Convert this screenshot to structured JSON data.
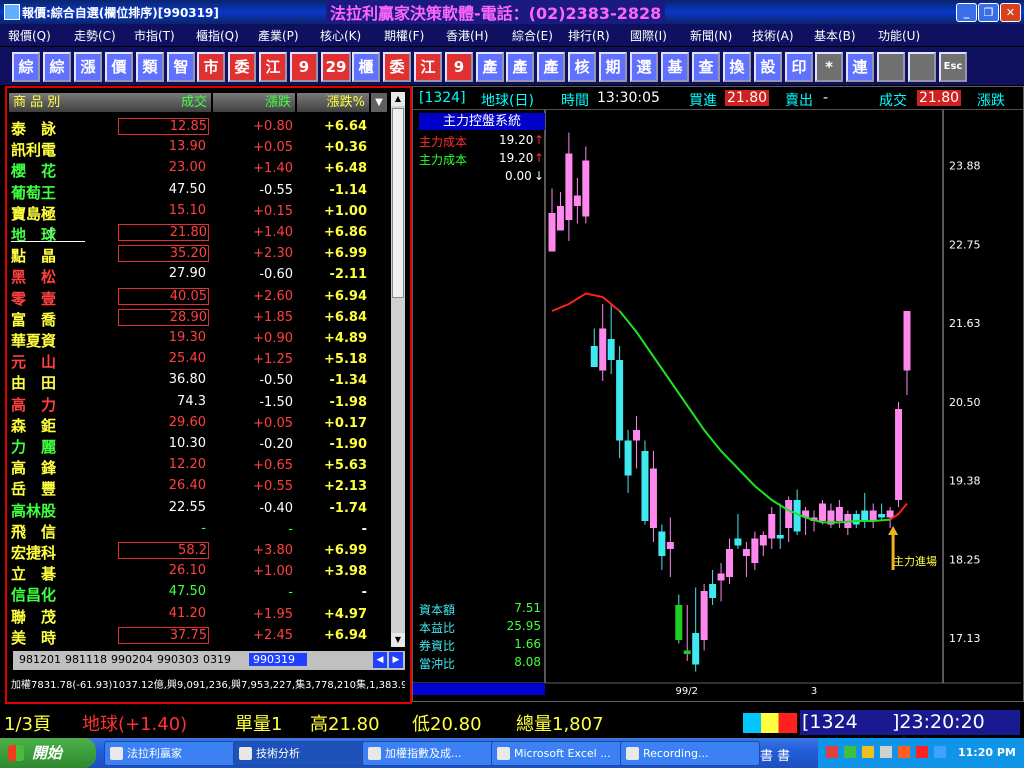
{
  "window": {
    "title": "報價:綜合自選(欄位排序)[990319]",
    "promo": "法拉利贏家決策軟體-電話：(02)2383-2828"
  },
  "menu": [
    "報價(Q)",
    "走勢(C)",
    "市指(T)",
    "櫃指(Q)",
    "產業(P)",
    "核心(K)",
    "期權(F)",
    "香港(H)",
    "綜合(E)",
    "排行(R)",
    "國際(I)",
    "新聞(N)",
    "技術(A)",
    "基本(B)",
    "功能(U)"
  ],
  "toolbar": [
    "綜",
    "綜",
    "漲",
    "價",
    "類",
    "智",
    "市",
    "委",
    "江",
    "9",
    "29",
    "櫃",
    "委",
    "江",
    "9",
    "產",
    "產",
    "產",
    "核",
    "期",
    "選",
    "基",
    "查",
    "換",
    "設",
    "印",
    "*",
    "連",
    "",
    "",
    "Esc"
  ],
  "quote_table": {
    "headers": {
      "name": "商 品 別",
      "price": "成交",
      "change": "漲跌",
      "pct": "漲跌%"
    },
    "rows": [
      {
        "name": "泰　詠",
        "price": "12.85",
        "change": "+0.80",
        "pct": "+6.64",
        "boxed": true
      },
      {
        "name": "訊利電",
        "price": "13.90",
        "change": "+0.05",
        "pct": "+0.36",
        "boxed": false
      },
      {
        "name": "櫻　花",
        "price": "23.00",
        "change": "+1.40",
        "pct": "+6.48",
        "boxed": false
      },
      {
        "name": "葡萄王",
        "price": "47.50",
        "change": "-0.55",
        "pct": "-1.14",
        "boxed": false
      },
      {
        "name": "寶島極",
        "price": "15.10",
        "change": "+0.15",
        "pct": "+1.00",
        "boxed": false
      },
      {
        "name": "地　球",
        "price": "21.80",
        "change": "+1.40",
        "pct": "+6.86",
        "boxed": true
      },
      {
        "name": "點　晶",
        "price": "35.20",
        "change": "+2.30",
        "pct": "+6.99",
        "boxed": true
      },
      {
        "name": "黑　松",
        "price": "27.90",
        "change": "-0.60",
        "pct": "-2.11",
        "boxed": false
      },
      {
        "name": "零　壹",
        "price": "40.05",
        "change": "+2.60",
        "pct": "+6.94",
        "boxed": true
      },
      {
        "name": "富　喬",
        "price": "28.90",
        "change": "+1.85",
        "pct": "+6.84",
        "boxed": true
      },
      {
        "name": "華夏資",
        "price": "19.30",
        "change": "+0.90",
        "pct": "+4.89",
        "boxed": false
      },
      {
        "name": "元　山",
        "price": "25.40",
        "change": "+1.25",
        "pct": "+5.18",
        "boxed": false
      },
      {
        "name": "由　田",
        "price": "36.80",
        "change": "-0.50",
        "pct": "-1.34",
        "boxed": false
      },
      {
        "name": "高　力",
        "price": "74.3",
        "change": "-1.50",
        "pct": "-1.98",
        "boxed": false
      },
      {
        "name": "森　鉅",
        "price": "29.60",
        "change": "+0.05",
        "pct": "+0.17",
        "boxed": false
      },
      {
        "name": "力　麗",
        "price": "10.30",
        "change": "-0.20",
        "pct": "-1.90",
        "boxed": false
      },
      {
        "name": "高　鋒",
        "price": "12.20",
        "change": "+0.65",
        "pct": "+5.63",
        "boxed": false
      },
      {
        "name": "岳　豐",
        "price": "26.40",
        "change": "+0.55",
        "pct": "+2.13",
        "boxed": false
      },
      {
        "name": "高林股",
        "price": "22.55",
        "change": "-0.40",
        "pct": "-1.74",
        "boxed": false
      },
      {
        "name": "飛　信",
        "price": "-",
        "change": "-",
        "pct": "-",
        "boxed": false
      },
      {
        "name": "宏捷科",
        "price": "58.2",
        "change": "+3.80",
        "pct": "+6.99",
        "boxed": true
      },
      {
        "name": "立　碁",
        "price": "26.10",
        "change": "+1.00",
        "pct": "+3.98",
        "boxed": false
      },
      {
        "name": "信昌化",
        "price": "47.50",
        "change": "-",
        "pct": "-",
        "boxed": false
      },
      {
        "name": "聯　茂",
        "price": "41.20",
        "change": "+1.95",
        "pct": "+4.97",
        "boxed": false
      },
      {
        "name": "美　時",
        "price": "37.75",
        "change": "+2.45",
        "pct": "+6.94",
        "boxed": true
      }
    ]
  },
  "sheet_tabs": [
    "981201",
    "981118",
    "990204",
    "990303",
    "0319",
    "990319"
  ],
  "ticker_text": "加權7831.78(-61.93)1037.12億,興9,091,236,興7,953,227,集3,778,210集,1,383.9",
  "chart_header": {
    "code": "[1324]",
    "name": "地球(日)",
    "time_label": "時間",
    "time": "13:30:05",
    "bid_label": "買進",
    "bid": "21.80",
    "ask_label": "賣出",
    "ask": "-",
    "last_label": "成交",
    "last": "21.80",
    "chg_label": "漲跌"
  },
  "indicator": {
    "title": "主力控盤系統",
    "line1_label": "主力成本",
    "line1_value": "19.20",
    "line2_label": "主力成本",
    "line2_value": "19.20",
    "line3_value": "0.00"
  },
  "fundamentals": [
    {
      "label": "資本額",
      "value": "7.51"
    },
    {
      "label": "本益比",
      "value": "25.95"
    },
    {
      "label": "券資比",
      "value": "1.66"
    },
    {
      "label": "當沖比",
      "value": "8.08"
    }
  ],
  "annotation": "主力進場",
  "colors": {
    "up": "#ff4040",
    "down": "#40ff40",
    "bull_candle": "#ff88ee",
    "bear_candle": "#40e8f0",
    "ma_red": "#ff2020",
    "ma_green": "#20e020"
  },
  "chart_data": {
    "type": "candlestick",
    "y_ticks": [
      "23.88",
      "22.75",
      "21.63",
      "20.50",
      "19.38",
      "18.25",
      "17.13"
    ],
    "ylim": [
      16.6,
      24.6
    ],
    "x_labels": [
      "99/2",
      "3"
    ],
    "candles": [
      {
        "o": 22.65,
        "h": 23.55,
        "l": 22.65,
        "c": 23.2
      },
      {
        "o": 22.95,
        "h": 23.5,
        "l": 22.95,
        "c": 23.3
      },
      {
        "o": 23.1,
        "h": 24.35,
        "l": 22.8,
        "c": 24.05
      },
      {
        "o": 23.3,
        "h": 23.7,
        "l": 23.05,
        "c": 23.45
      },
      {
        "o": 23.15,
        "h": 24.15,
        "l": 23.05,
        "c": 23.95
      },
      {
        "o": 21.3,
        "h": 21.55,
        "l": 21.0,
        "c": 21.0
      },
      {
        "o": 20.95,
        "h": 21.9,
        "l": 20.8,
        "c": 21.55
      },
      {
        "o": 21.4,
        "h": 21.9,
        "l": 20.9,
        "c": 21.1
      },
      {
        "o": 21.1,
        "h": 21.3,
        "l": 19.7,
        "c": 19.95
      },
      {
        "o": 19.95,
        "h": 20.1,
        "l": 19.2,
        "c": 19.45
      },
      {
        "o": 19.95,
        "h": 20.3,
        "l": 19.55,
        "c": 20.1
      },
      {
        "o": 19.8,
        "h": 19.95,
        "l": 18.75,
        "c": 18.8
      },
      {
        "o": 18.7,
        "h": 19.8,
        "l": 18.5,
        "c": 19.55
      },
      {
        "o": 18.65,
        "h": 18.75,
        "l": 18.1,
        "c": 18.3
      },
      {
        "o": 18.4,
        "h": 18.85,
        "l": 18.0,
        "c": 18.5
      },
      {
        "o": 17.6,
        "h": 17.75,
        "l": 17.05,
        "c": 17.1
      },
      {
        "o": 16.9,
        "h": 17.6,
        "l": 16.8,
        "c": 16.95
      },
      {
        "o": 17.2,
        "h": 17.85,
        "l": 16.65,
        "c": 16.75
      },
      {
        "o": 17.1,
        "h": 17.9,
        "l": 16.95,
        "c": 17.8
      },
      {
        "o": 17.9,
        "h": 18.1,
        "l": 17.6,
        "c": 17.7
      },
      {
        "o": 17.95,
        "h": 18.2,
        "l": 17.65,
        "c": 18.05
      },
      {
        "o": 18.0,
        "h": 18.55,
        "l": 17.9,
        "c": 18.4
      },
      {
        "o": 18.55,
        "h": 18.9,
        "l": 18.4,
        "c": 18.45
      },
      {
        "o": 18.3,
        "h": 18.5,
        "l": 18.0,
        "c": 18.4
      },
      {
        "o": 18.2,
        "h": 18.65,
        "l": 18.1,
        "c": 18.55
      },
      {
        "o": 18.45,
        "h": 18.65,
        "l": 18.3,
        "c": 18.6
      },
      {
        "o": 18.55,
        "h": 19.0,
        "l": 18.4,
        "c": 18.9
      },
      {
        "o": 18.6,
        "h": 19.05,
        "l": 18.4,
        "c": 18.55
      },
      {
        "o": 18.7,
        "h": 19.15,
        "l": 18.5,
        "c": 19.1
      },
      {
        "o": 19.1,
        "h": 19.25,
        "l": 18.6,
        "c": 18.65
      },
      {
        "o": 18.85,
        "h": 19.0,
        "l": 18.6,
        "c": 18.95
      },
      {
        "o": 18.8,
        "h": 18.95,
        "l": 18.65,
        "c": 18.85
      },
      {
        "o": 18.8,
        "h": 19.1,
        "l": 18.75,
        "c": 19.05
      },
      {
        "o": 18.75,
        "h": 19.05,
        "l": 18.7,
        "c": 18.95
      },
      {
        "o": 18.8,
        "h": 19.1,
        "l": 18.7,
        "c": 19.0
      },
      {
        "o": 18.7,
        "h": 18.95,
        "l": 18.6,
        "c": 18.9
      },
      {
        "o": 18.9,
        "h": 18.95,
        "l": 18.7,
        "c": 18.75
      },
      {
        "o": 18.95,
        "h": 19.2,
        "l": 18.7,
        "c": 18.8
      },
      {
        "o": 18.8,
        "h": 19.05,
        "l": 18.7,
        "c": 18.95
      },
      {
        "o": 18.9,
        "h": 19.05,
        "l": 18.8,
        "c": 18.85
      },
      {
        "o": 18.85,
        "h": 19.0,
        "l": 18.7,
        "c": 18.95
      },
      {
        "o": 19.1,
        "h": 20.5,
        "l": 19.0,
        "c": 20.4
      },
      {
        "o": 20.95,
        "h": 21.8,
        "l": 20.6,
        "c": 21.8
      }
    ],
    "ma": [
      [
        0,
        21.8
      ],
      [
        2,
        21.9
      ],
      [
        4,
        22.05
      ],
      [
        6,
        22.0
      ],
      [
        8,
        21.8
      ],
      [
        10,
        21.5
      ],
      [
        12,
        21.15
      ],
      [
        14,
        20.8
      ],
      [
        16,
        20.45
      ],
      [
        18,
        20.1
      ],
      [
        20,
        19.8
      ],
      [
        22,
        19.55
      ],
      [
        24,
        19.3
      ],
      [
        26,
        19.1
      ],
      [
        28,
        18.95
      ],
      [
        30,
        18.85
      ],
      [
        32,
        18.78
      ],
      [
        34,
        18.78
      ],
      [
        36,
        18.8
      ],
      [
        38,
        18.8
      ],
      [
        40,
        18.82
      ],
      [
        41,
        18.9
      ],
      [
        42,
        19.05
      ]
    ]
  },
  "status": {
    "page": "1/3頁",
    "stock": "地球(+1.40)",
    "vol": "單量1",
    "high": "高21.80",
    "low": "低20.80",
    "total": "總量1,807",
    "code": "[1324",
    "time": "]23:20:20"
  },
  "taskbar": {
    "start": "開始",
    "tasks": [
      "法拉利贏家",
      "技術分析",
      "加權指數及成...",
      "Microsoft Excel ...",
      "Recording..."
    ],
    "ime": "書 書",
    "clock": "11:20 PM"
  }
}
